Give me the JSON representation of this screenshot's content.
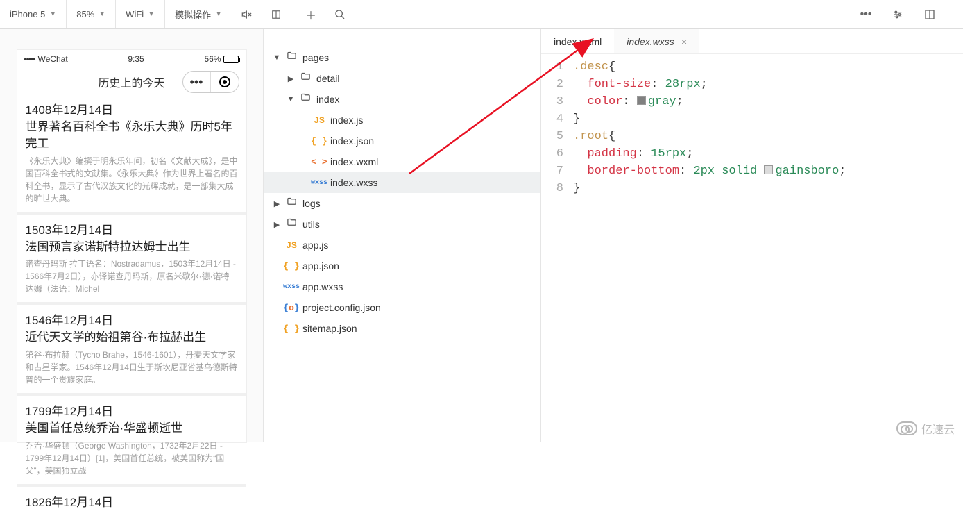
{
  "toolbar": {
    "device": "iPhone 5",
    "zoom": "85%",
    "network": "WiFi",
    "sim_ops": "模拟操作"
  },
  "tabs": [
    {
      "label": "index.wxml",
      "active": false,
      "closable": false
    },
    {
      "label": "index.wxss",
      "active": true,
      "closable": true
    }
  ],
  "simulator": {
    "carrier": "WeChat",
    "time": "9:35",
    "battery_pct": "56%",
    "page_title": "历史上的今天",
    "cards": [
      {
        "date": "1408年12月14日",
        "title": "世界著名百科全书《永乐大典》历时5年完工",
        "desc": "《永乐大典》编撰于明永乐年间，初名《文献大成》，是中国百科全书式的文献集。《永乐大典》作为世界上著名的百科全书，显示了古代汉族文化的光辉成就，是一部集大成的旷世大典。"
      },
      {
        "date": "1503年12月14日",
        "title": "法国预言家诺斯特拉达姆士出生",
        "desc": "诺查丹玛斯 拉丁语名：Nostradamus，1503年12月14日 - 1566年7月2日），亦译诺查丹玛斯，原名米歇尔·德·诺特达姆（法语：Michel"
      },
      {
        "date": "1546年12月14日",
        "title": "近代天文学的始祖第谷·布拉赫出生",
        "desc": "第谷·布拉赫（Tycho Brahe，1546-1601），丹麦天文学家和占星学家。1546年12月14日生于斯坎尼亚省基乌德斯特普的一个贵族家庭。"
      },
      {
        "date": "1799年12月14日",
        "title": "美国首任总统乔治·华盛顿逝世",
        "desc": "乔治·华盛顿（George Washington，1732年2月22日 - 1799年12月14日）[1]，美国首任总统，被美国称为“国父”，美国独立战"
      },
      {
        "date": "1826年12月14日",
        "title": "",
        "desc": ""
      }
    ]
  },
  "tree": [
    {
      "depth": 0,
      "type": "folder",
      "open": true,
      "label": "pages"
    },
    {
      "depth": 1,
      "type": "folder",
      "open": false,
      "label": "detail"
    },
    {
      "depth": 1,
      "type": "folder",
      "open": true,
      "label": "index"
    },
    {
      "depth": 2,
      "type": "js",
      "label": "index.js"
    },
    {
      "depth": 2,
      "type": "json",
      "label": "index.json"
    },
    {
      "depth": 2,
      "type": "wxml",
      "label": "index.wxml"
    },
    {
      "depth": 2,
      "type": "wxss",
      "label": "index.wxss",
      "selected": true
    },
    {
      "depth": 0,
      "type": "folder",
      "open": false,
      "label": "logs"
    },
    {
      "depth": 0,
      "type": "folder",
      "open": false,
      "label": "utils"
    },
    {
      "depth": 0,
      "type": "js",
      "label": "app.js"
    },
    {
      "depth": 0,
      "type": "json",
      "label": "app.json"
    },
    {
      "depth": 0,
      "type": "wxss",
      "label": "app.wxss"
    },
    {
      "depth": 0,
      "type": "proj",
      "label": "project.config.json"
    },
    {
      "depth": 0,
      "type": "json",
      "label": "sitemap.json"
    }
  ],
  "code": {
    "lines": [
      {
        "n": 1,
        "html": "<span class='sel-class'>.desc</span>{"
      },
      {
        "n": 2,
        "html": "  <span class='prop'>font-size</span>: <span class='val'>28rpx</span>;"
      },
      {
        "n": 3,
        "html": "  <span class='prop'>color</span>: <span class='swatch' style='background:gray'></span><span class='val'>gray</span>;"
      },
      {
        "n": 4,
        "html": "}"
      },
      {
        "n": 5,
        "html": "<span class='sel-class'>.root</span>{"
      },
      {
        "n": 6,
        "html": "  <span class='prop'>padding</span>: <span class='val'>15rpx</span>;"
      },
      {
        "n": 7,
        "html": "  <span class='prop'>border-bottom</span>: <span class='val'>2px</span> <span class='val'>solid</span> <span class='swatch' style='background:gainsboro'></span><span class='val'>gainsboro</span>;"
      },
      {
        "n": 8,
        "html": "}"
      }
    ]
  },
  "watermark": "亿速云"
}
